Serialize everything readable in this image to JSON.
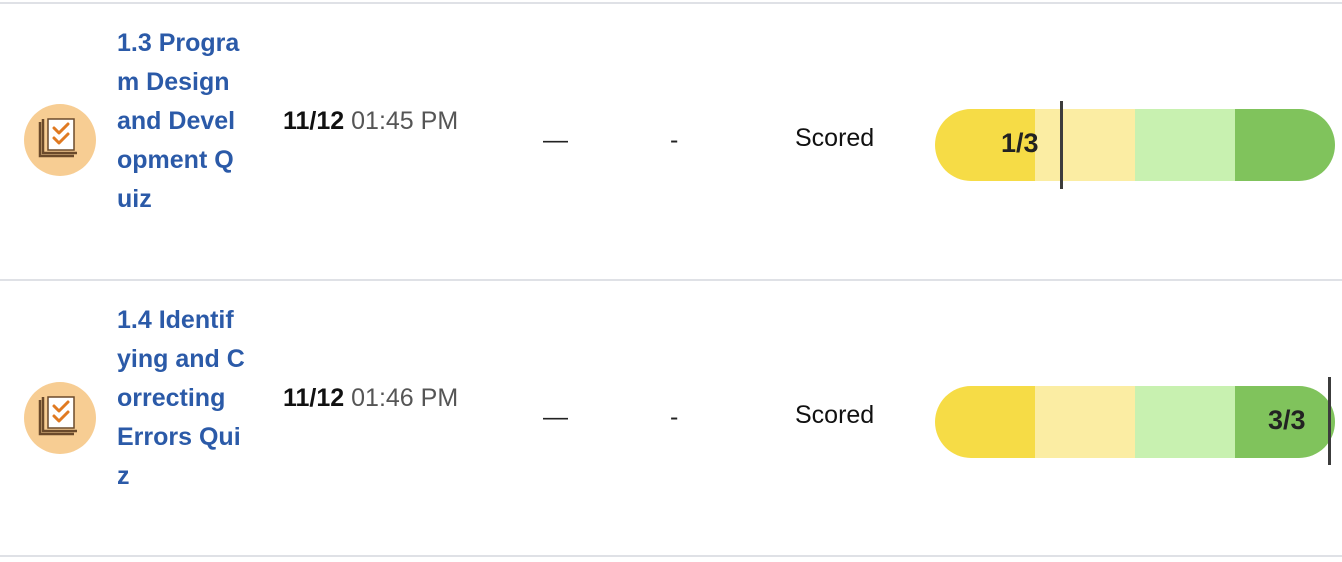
{
  "rows": [
    {
      "title": "1.3 Program Design and Development Quiz",
      "date_day": "11/12",
      "date_time": "01:45 PM",
      "col_dash": "—",
      "col_hyphen": "-",
      "status": "Scored",
      "score_label": "1/3",
      "score_fraction": 0.3333,
      "icon": "quiz-checklist-icon"
    },
    {
      "title": "1.4 Identifying and Correcting Errors Quiz",
      "date_day": "11/12",
      "date_time": "01:46 PM",
      "col_dash": "—",
      "col_hyphen": "-",
      "status": "Scored",
      "score_label": "3/3",
      "score_fraction": 1.0,
      "icon": "quiz-checklist-icon"
    }
  ],
  "colors": {
    "title": "#2b5aa8",
    "icon_bg": "#f7cd93",
    "seg1": "#f6dc46",
    "seg2": "#fbeda3",
    "seg3": "#c8f1b0",
    "seg4": "#80c35c"
  }
}
